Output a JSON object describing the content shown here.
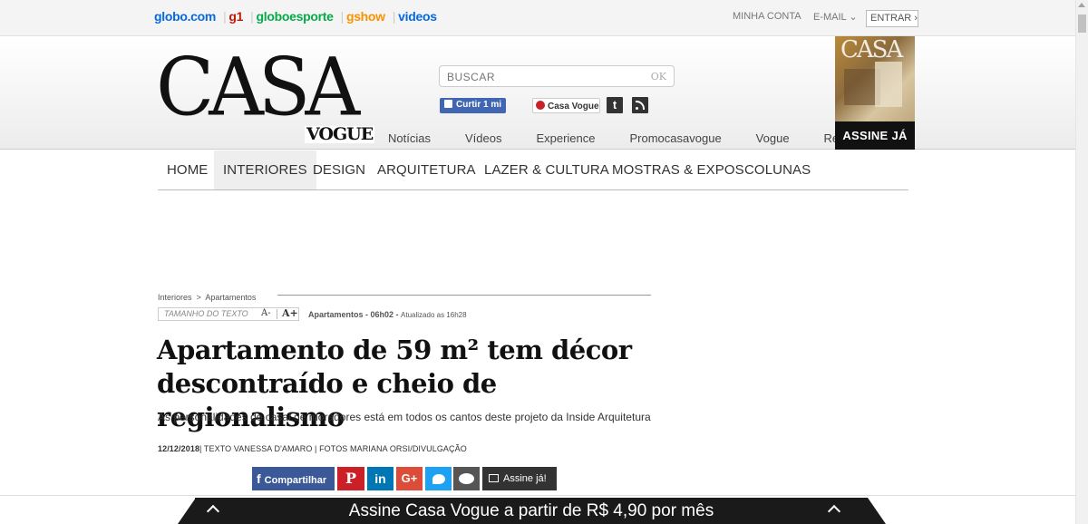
{
  "globobar": {
    "links": [
      "globo.com",
      "g1",
      "globoesporte",
      "gshow",
      "videos"
    ],
    "minha_conta": "MINHA CONTA",
    "email": "E-MAIL",
    "entrar": "ENTRAR ›"
  },
  "header": {
    "logo_casa": "CASA",
    "logo_vogue": "VOGUE",
    "search_placeholder": "BUSCAR",
    "search_ok": "OK",
    "fb_like": "Curtir 1 mi",
    "pin_label": "Casa Vogue",
    "subnav": [
      "Notícias",
      "Vídeos",
      "Experience",
      "Promocasavogue",
      "Vogue",
      "Revista"
    ],
    "cover_title": "CASA",
    "assine": "ASSINE JÁ"
  },
  "mainnav": [
    "HOME",
    "INTERIORES",
    "DESIGN",
    "ARQUITETURA",
    "LAZER & CULTURA",
    "MOSTRAS & EXPOS",
    "COLUNAS"
  ],
  "article": {
    "breadcrumb": [
      "Interiores",
      "Apartamentos"
    ],
    "breadcrumb_sep": ">",
    "text_size_label": "TAMANHO DO TEXTO",
    "text_minus": "A-",
    "text_plus": "A+",
    "meta_section_time": "Apartamentos - 06h02 -",
    "meta_updated": "Atualizado as 16h28",
    "headline": "Apartamento de 59 m² tem décor descontraído e cheio de regionalismo",
    "dek": "As personalidades do casal de moradores está em todos os cantos deste projeto da Inside Arquitetura",
    "date": "12/12/2018",
    "credits": "| TEXTO VANESSA D'AMARO | FOTOS MARIANA ORSI/DIVULGAÇÃO"
  },
  "share": {
    "facebook": "Compartilhar",
    "pinterest": "P",
    "linkedin": "in",
    "gplus": "G+",
    "assine": "Assine já!"
  },
  "banner": {
    "text": "Assine Casa Vogue a partir de R$ 4,90 por mês"
  },
  "colors": {
    "globo_blue": "#0669de",
    "g1_red": "#c4170c",
    "ge_green": "#06aa48",
    "gshow_orange": "#fa9300",
    "facebook": "#3b5998",
    "pinterest": "#cb2027",
    "linkedin": "#0077b5",
    "gplus": "#dd4b39",
    "twitter": "#1da1f2"
  }
}
